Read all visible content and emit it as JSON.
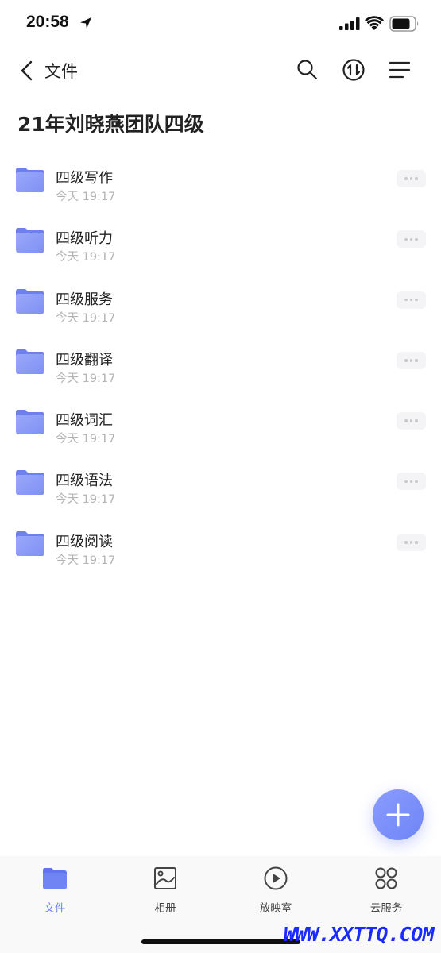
{
  "status": {
    "time": "20:58"
  },
  "nav": {
    "back_label": "文件"
  },
  "page": {
    "title": "21年刘晓燕团队四级"
  },
  "files": [
    {
      "name": "四级写作",
      "date": "今天 19:17"
    },
    {
      "name": "四级听力",
      "date": "今天 19:17"
    },
    {
      "name": "四级服务",
      "date": "今天 19:17"
    },
    {
      "name": "四级翻译",
      "date": "今天 19:17"
    },
    {
      "name": "四级词汇",
      "date": "今天 19:17"
    },
    {
      "name": "四级语法",
      "date": "今天 19:17"
    },
    {
      "name": "四级阅读",
      "date": "今天 19:17"
    }
  ],
  "tabs": [
    {
      "label": "文件",
      "icon": "folder-icon"
    },
    {
      "label": "相册",
      "icon": "photo-icon"
    },
    {
      "label": "放映室",
      "icon": "play-icon"
    },
    {
      "label": "云服务",
      "icon": "grid-circles-icon"
    }
  ],
  "watermark": "WWW.XXTTQ.COM",
  "colors": {
    "accent": "#6b7ff0",
    "folder": "#8d9cf7",
    "fab": "#7b8ff8"
  }
}
